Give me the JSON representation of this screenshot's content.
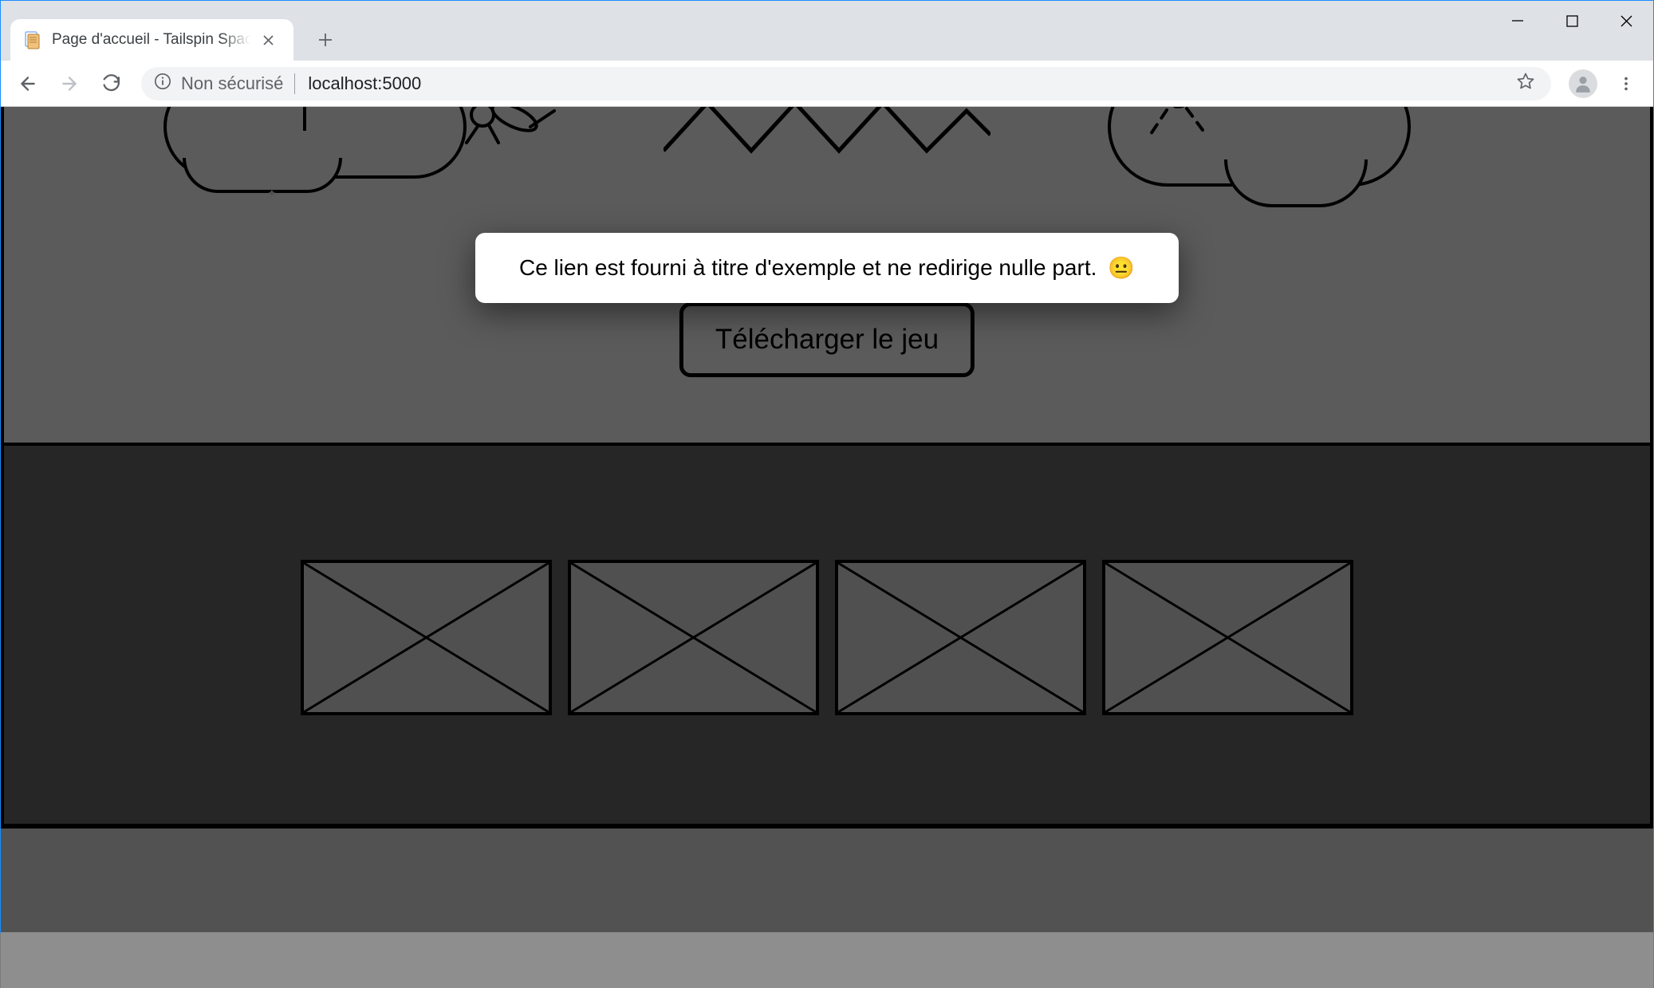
{
  "browser": {
    "tab_title": "Page d'accueil - Tailspin SpaceGame",
    "security_label": "Non sécurisé",
    "url": "localhost:5000"
  },
  "page": {
    "download_button_label": "Télécharger le jeu"
  },
  "toast": {
    "message": "Ce lien est fourni à titre d'exemple et ne redirige nulle part.",
    "emoji": "😐"
  }
}
